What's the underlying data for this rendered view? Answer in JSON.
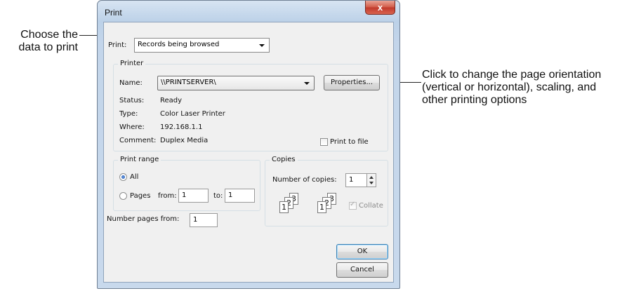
{
  "callouts": {
    "left_line1": "Choose the",
    "left_line2": "data to print",
    "right_line1": "Click to change the page orientation",
    "right_line2": "(vertical or horizontal), scaling, and",
    "right_line3": "other printing options"
  },
  "dialog": {
    "title": "Print",
    "close_label": "x",
    "print_label": "Print:",
    "print_value": "Records being browsed",
    "printer": {
      "group_title": "Printer",
      "name_label": "Name:",
      "name_value": "\\\\PRINTSERVER\\",
      "properties_label": "Properties...",
      "status_label": "Status:",
      "status_value": "Ready",
      "type_label": "Type:",
      "type_value": "Color Laser  Printer",
      "where_label": "Where:",
      "where_value": "192.168.1.1",
      "comment_label": "Comment:",
      "comment_value": "Duplex Media",
      "print_to_file_label": "Print to file",
      "print_to_file_checked": false
    },
    "range": {
      "group_title": "Print range",
      "all_label": "All",
      "all_selected": true,
      "pages_label": "Pages",
      "from_label": "from:",
      "from_value": "1",
      "to_label": "to:",
      "to_value": "1"
    },
    "copies": {
      "group_title": "Copies",
      "number_label": "Number of copies:",
      "number_value": "1",
      "collate_label": "Collate",
      "collate_checked": true,
      "page_numbers": [
        "1",
        "2",
        "3"
      ]
    },
    "number_pages_label": "Number pages from:",
    "number_pages_value": "1",
    "ok_label": "OK",
    "cancel_label": "Cancel"
  }
}
